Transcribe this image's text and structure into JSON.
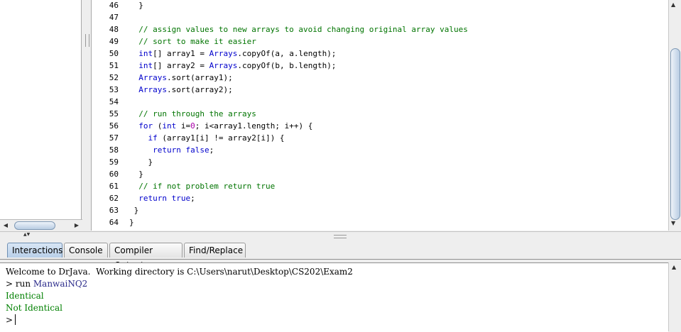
{
  "editor": {
    "lines": [
      {
        "n": "46",
        "segs": [
          {
            "t": "  }",
            "c": ""
          }
        ]
      },
      {
        "n": "47",
        "segs": []
      },
      {
        "n": "48",
        "segs": [
          {
            "t": "  ",
            "c": ""
          },
          {
            "t": "// assign values to new arrays to avoid changing original array values",
            "c": "cm"
          }
        ]
      },
      {
        "n": "49",
        "segs": [
          {
            "t": "  ",
            "c": ""
          },
          {
            "t": "// sort to make it easier",
            "c": "cm"
          }
        ]
      },
      {
        "n": "50",
        "segs": [
          {
            "t": "  ",
            "c": ""
          },
          {
            "t": "int",
            "c": "ty"
          },
          {
            "t": "[] array1 = ",
            "c": ""
          },
          {
            "t": "Arrays",
            "c": "ty"
          },
          {
            "t": ".copyOf(a, a.length);",
            "c": ""
          }
        ]
      },
      {
        "n": "51",
        "segs": [
          {
            "t": "  ",
            "c": ""
          },
          {
            "t": "int",
            "c": "ty"
          },
          {
            "t": "[] array2 = ",
            "c": ""
          },
          {
            "t": "Arrays",
            "c": "ty"
          },
          {
            "t": ".copyOf(b, b.length);",
            "c": ""
          }
        ]
      },
      {
        "n": "52",
        "segs": [
          {
            "t": "  ",
            "c": ""
          },
          {
            "t": "Arrays",
            "c": "ty"
          },
          {
            "t": ".sort(array1);",
            "c": ""
          }
        ]
      },
      {
        "n": "53",
        "segs": [
          {
            "t": "  ",
            "c": ""
          },
          {
            "t": "Arrays",
            "c": "ty"
          },
          {
            "t": ".sort(array2);",
            "c": ""
          }
        ]
      },
      {
        "n": "54",
        "segs": []
      },
      {
        "n": "55",
        "segs": [
          {
            "t": "  ",
            "c": ""
          },
          {
            "t": "// run through the arrays",
            "c": "cm"
          }
        ]
      },
      {
        "n": "56",
        "segs": [
          {
            "t": "  ",
            "c": ""
          },
          {
            "t": "for",
            "c": "kw"
          },
          {
            "t": " (",
            "c": ""
          },
          {
            "t": "int",
            "c": "ty"
          },
          {
            "t": " i=",
            "c": ""
          },
          {
            "t": "0",
            "c": "num"
          },
          {
            "t": "; i<array1.length; i++) {",
            "c": ""
          }
        ]
      },
      {
        "n": "57",
        "segs": [
          {
            "t": "    ",
            "c": ""
          },
          {
            "t": "if",
            "c": "kw"
          },
          {
            "t": " (array1[i] != array2[i]) {",
            "c": ""
          }
        ]
      },
      {
        "n": "58",
        "segs": [
          {
            "t": "     ",
            "c": ""
          },
          {
            "t": "return",
            "c": "kw"
          },
          {
            "t": " ",
            "c": ""
          },
          {
            "t": "false",
            "c": "kw"
          },
          {
            "t": ";",
            "c": ""
          }
        ]
      },
      {
        "n": "59",
        "segs": [
          {
            "t": "    }",
            "c": ""
          }
        ]
      },
      {
        "n": "60",
        "segs": [
          {
            "t": "  }",
            "c": ""
          }
        ]
      },
      {
        "n": "61",
        "segs": [
          {
            "t": "  ",
            "c": ""
          },
          {
            "t": "// if not problem return true",
            "c": "cm"
          }
        ]
      },
      {
        "n": "62",
        "segs": [
          {
            "t": "  ",
            "c": ""
          },
          {
            "t": "return",
            "c": "kw"
          },
          {
            "t": " ",
            "c": ""
          },
          {
            "t": "true",
            "c": "kw"
          },
          {
            "t": ";",
            "c": ""
          }
        ]
      },
      {
        "n": "63",
        "segs": [
          {
            "t": " }",
            "c": ""
          }
        ]
      },
      {
        "n": "64",
        "segs": [
          {
            "t": "}",
            "c": ""
          }
        ]
      }
    ]
  },
  "tabs": [
    {
      "id": "interactions",
      "label": "Interactions",
      "active": true
    },
    {
      "id": "console",
      "label": "Console",
      "active": false
    },
    {
      "id": "compiler-output",
      "label": "Compiler Output",
      "active": false
    },
    {
      "id": "find-replace",
      "label": "Find/Replace",
      "active": false
    }
  ],
  "interactions": {
    "welcome": "Welcome to DrJava.  Working directory is C:\\Users\\narut\\Desktop\\CS202\\Exam2",
    "prompt": ">",
    "command_prefix": " run ",
    "command_class": "ManwaiNQ2",
    "output": [
      "Identical",
      "Not Identical"
    ],
    "current_prompt": ">"
  },
  "icons": {
    "left": "◀",
    "right": "▶",
    "up": "▲",
    "down": "▼",
    "split": "▲▼"
  },
  "colors": {
    "comment": "#007400",
    "keyword": "#0000cc",
    "number": "#aa00aa",
    "output": "#008000"
  }
}
